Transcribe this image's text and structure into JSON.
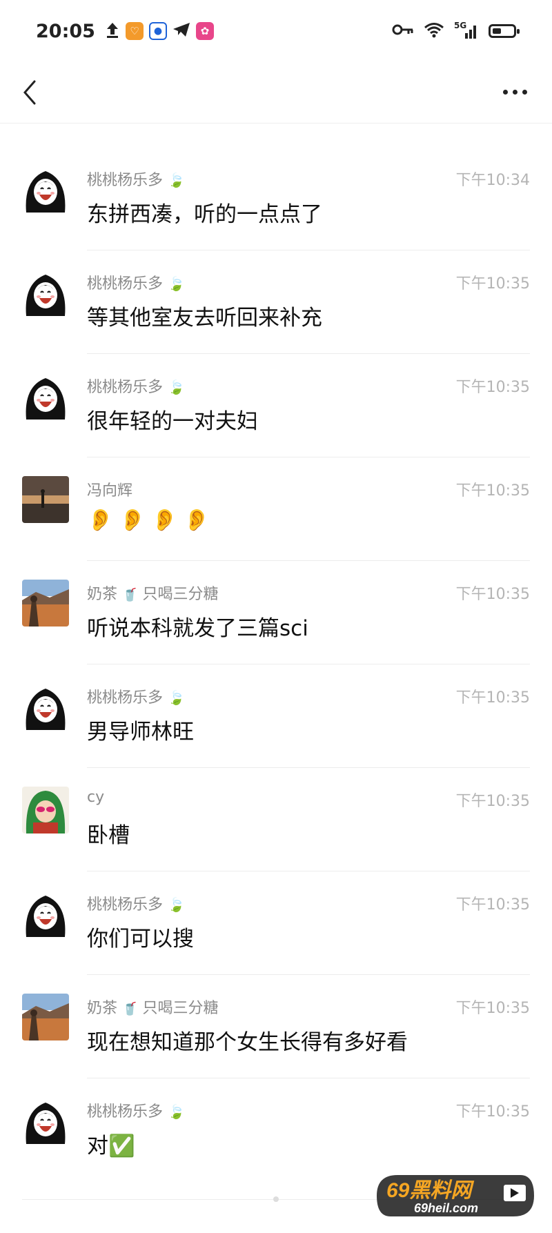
{
  "status_bar": {
    "time": "20:05",
    "network": "5G",
    "icons": [
      "upload-icon",
      "taobao-icon",
      "map-icon",
      "telegram-icon",
      "app-icon",
      "key-icon",
      "wifi-icon",
      "signal-icon",
      "battery-icon"
    ]
  },
  "nav": {
    "back_icon": "chevron-left-icon",
    "more_icon": "more-dots-icon"
  },
  "messages": [
    {
      "sender": "桃桃杨乐多",
      "badge": "🍃",
      "time": "下午10:34",
      "text": "东拼西凑，听的一点点了",
      "avatar": "girl-cartoon"
    },
    {
      "sender": "桃桃杨乐多",
      "badge": "🍃",
      "time": "下午10:35",
      "text": "等其他室友去听回来补充",
      "avatar": "girl-cartoon"
    },
    {
      "sender": "桃桃杨乐多",
      "badge": "🍃",
      "time": "下午10:35",
      "text": "很年轻的一对夫妇",
      "avatar": "girl-cartoon"
    },
    {
      "sender": "冯向辉",
      "badge": "",
      "time": "下午10:35",
      "text": "👂👂👂👂",
      "avatar": "beach-sunset"
    },
    {
      "sender": "奶茶",
      "badge": "🥤",
      "sender_suffix": "只喝三分糖",
      "time": "下午10:35",
      "text": "听说本科就发了三篇sci",
      "avatar": "desert-landscape"
    },
    {
      "sender": "桃桃杨乐多",
      "badge": "🍃",
      "time": "下午10:35",
      "text": "男导师林旺",
      "avatar": "girl-cartoon"
    },
    {
      "sender": "cy",
      "badge": "",
      "time": "下午10:35",
      "text": "卧槽",
      "avatar": "green-hood-kid"
    },
    {
      "sender": "桃桃杨乐多",
      "badge": "🍃",
      "time": "下午10:35",
      "text": "你们可以搜",
      "avatar": "girl-cartoon"
    },
    {
      "sender": "奶茶",
      "badge": "🥤",
      "sender_suffix": "只喝三分糖",
      "time": "下午10:35",
      "text": "现在想知道那个女生长得有多好看",
      "avatar": "desert-landscape"
    },
    {
      "sender": "桃桃杨乐多",
      "badge": "🍃",
      "time": "下午10:35",
      "text": "对✅",
      "avatar": "girl-cartoon"
    }
  ],
  "watermark": {
    "line1": "69黑料网",
    "line2": "69heil.com"
  }
}
